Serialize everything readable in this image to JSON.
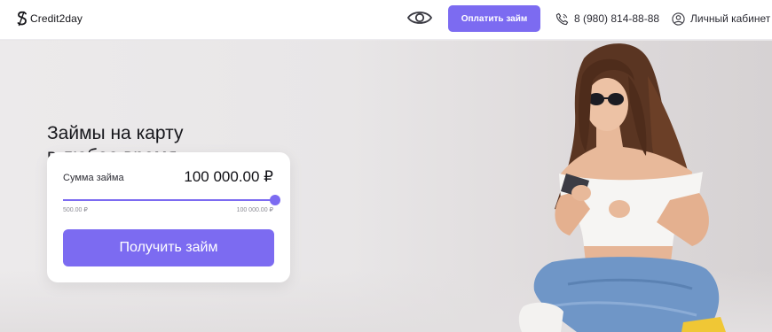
{
  "header": {
    "logo_text": "Credit2day",
    "pay_label": "Оплатить займ",
    "phone": "8 (980) 814-88-88",
    "cabinet": "Личный кабинет"
  },
  "hero": {
    "title": "Займы на карту\nв любое время"
  },
  "card": {
    "sum_label": "Сумма займа",
    "sum_value": "100 000.00 ₽",
    "min_label": "500.00 ₽",
    "max_label": "100 000.00 ₽",
    "slider_percent": 100,
    "button_label": "Получить займ"
  },
  "colors": {
    "accent": "#7c6bf1"
  }
}
